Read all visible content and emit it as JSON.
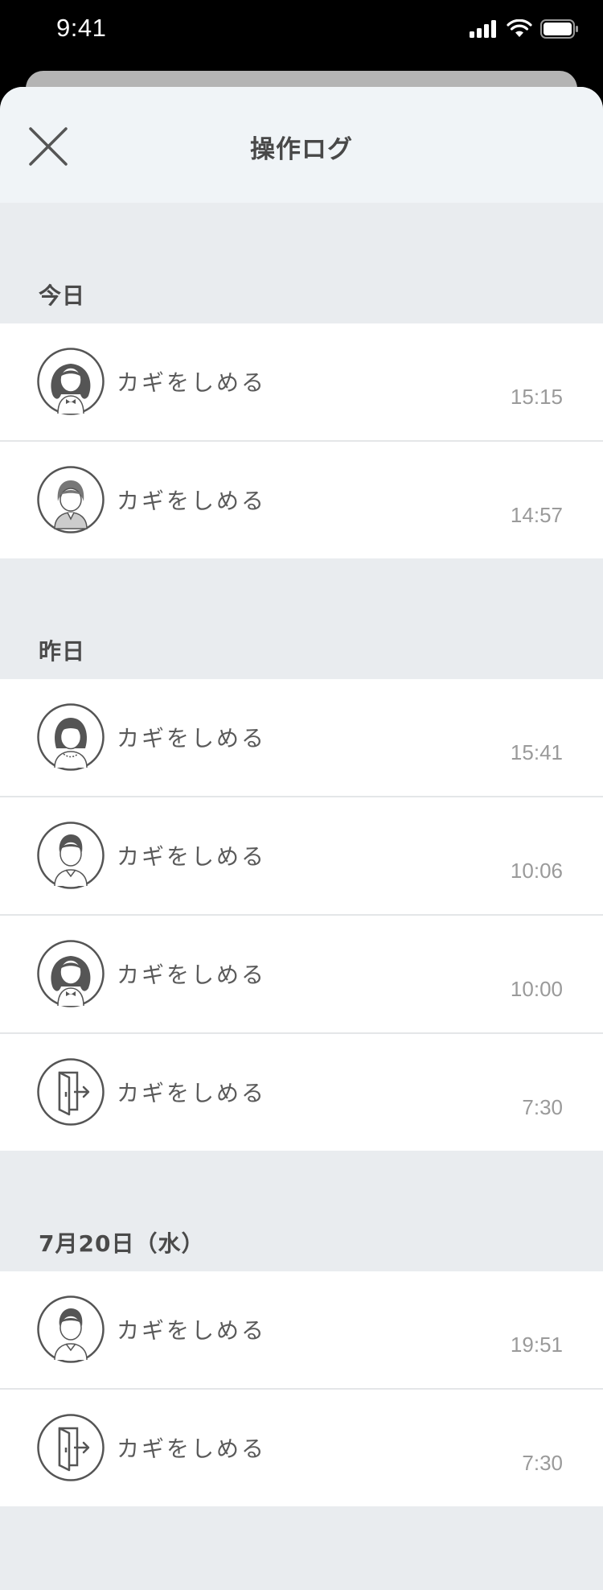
{
  "status_bar": {
    "time": "9:41"
  },
  "header": {
    "title": "操作ログ"
  },
  "sections": [
    {
      "label": "今日",
      "items": [
        {
          "avatar": "woman-long-hair-avatar",
          "action": "カギをしめる",
          "time": "15:15"
        },
        {
          "avatar": "short-hair-avatar",
          "action": "カギをしめる",
          "time": "14:57"
        }
      ]
    },
    {
      "label": "昨日",
      "items": [
        {
          "avatar": "woman-bob-avatar",
          "action": "カギをしめる",
          "time": "15:41"
        },
        {
          "avatar": "man-avatar",
          "action": "カギをしめる",
          "time": "10:06"
        },
        {
          "avatar": "woman-long-hair-avatar",
          "action": "カギをしめる",
          "time": "10:00"
        },
        {
          "avatar": "door-exit-icon",
          "action": "カギをしめる",
          "time": "7:30"
        }
      ]
    },
    {
      "label": "7月20日（水）",
      "items": [
        {
          "avatar": "man-avatar",
          "action": "カギをしめる",
          "time": "19:51"
        },
        {
          "avatar": "door-exit-icon",
          "action": "カギをしめる",
          "time": "7:30"
        }
      ]
    }
  ]
}
